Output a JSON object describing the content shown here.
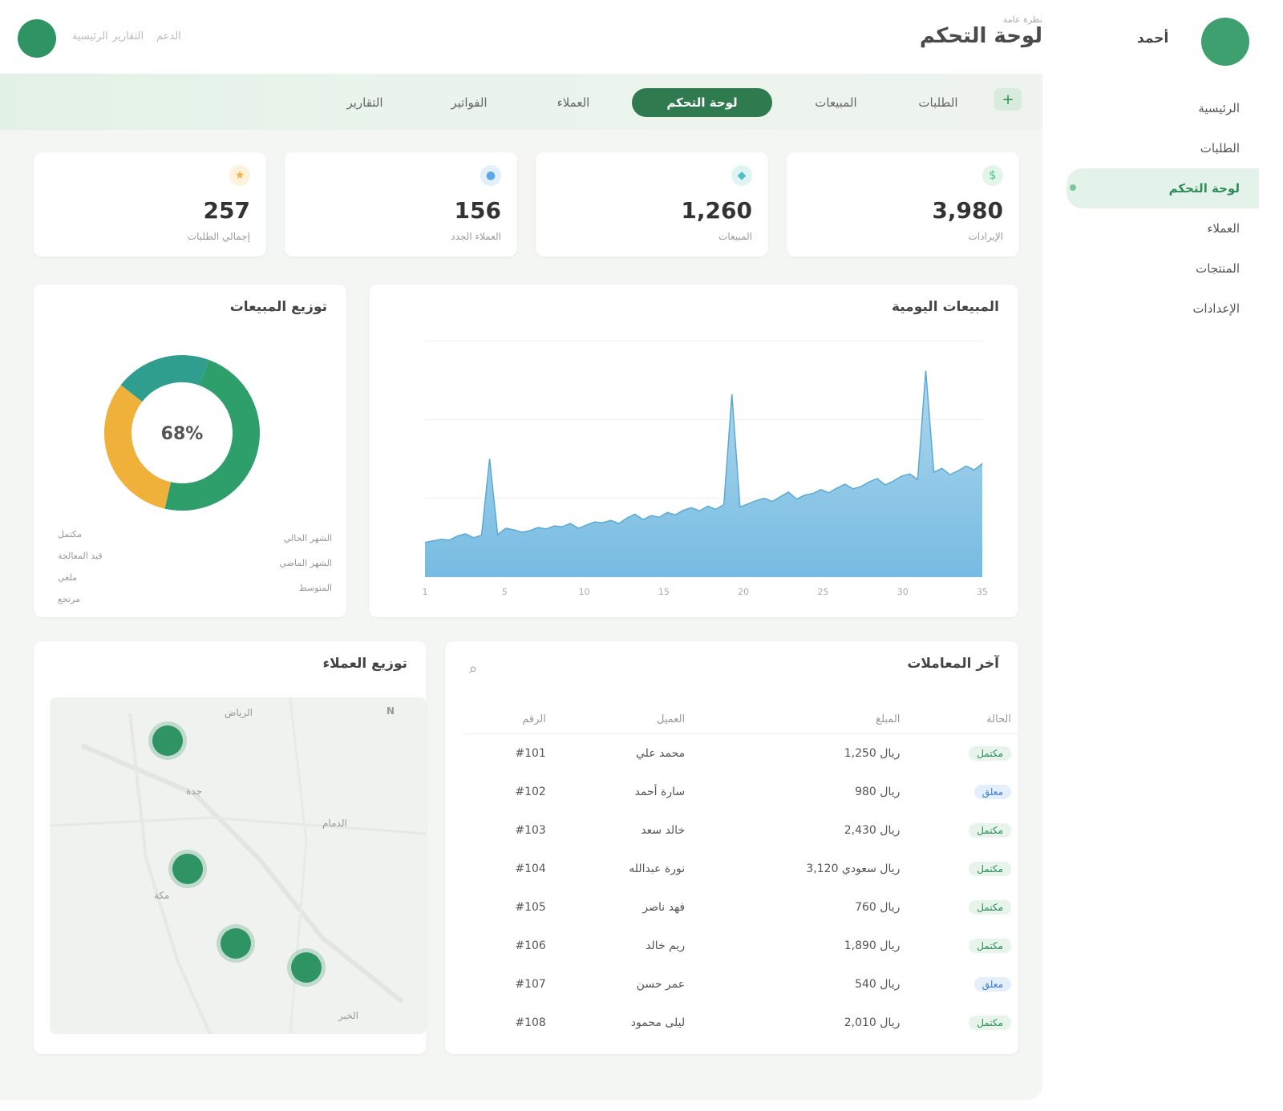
{
  "header": {
    "title": "لوحة التحكم",
    "subtitle": "نظرة عامة",
    "top_links": [
      "الرئيسية",
      "التقارير",
      "الدعم"
    ],
    "user_name": "أحمد"
  },
  "sidebar": {
    "items": [
      {
        "label": "الرئيسية"
      },
      {
        "label": "الطلبات"
      },
      {
        "label": "لوحة التحكم",
        "active": true
      },
      {
        "label": "العملاء"
      },
      {
        "label": "المنتجات"
      },
      {
        "label": "الإعدادات"
      }
    ]
  },
  "tabs": [
    {
      "label": "التقارير"
    },
    {
      "label": "الفواتير"
    },
    {
      "label": "العملاء"
    },
    {
      "label": "لوحة التحكم",
      "active": true
    },
    {
      "label": "المبيعات"
    },
    {
      "label": "الطلبات"
    }
  ],
  "kpis": [
    {
      "value": "257",
      "label": "إجمالي الطلبات",
      "icon": "star-icon",
      "color": "#f2b33d"
    },
    {
      "value": "156",
      "label": "العملاء الجدد",
      "icon": "user-icon",
      "color": "#5aa9e6"
    },
    {
      "value": "1,260",
      "label": "المبيعات",
      "icon": "cart-icon",
      "color": "#4fbfc1"
    },
    {
      "value": "3,980",
      "label": "الإيرادات",
      "icon": "dollar-icon",
      "color": "#4fbf85"
    }
  ],
  "donut": {
    "title": "توزيع المبيعات",
    "center": "68%",
    "left_legend": [
      "مكتمل",
      "قيد المعالجة",
      "ملغي",
      "مرتجع"
    ],
    "right_legend": [
      "الشهر الحالي",
      "الشهر الماضي",
      "المتوسط"
    ]
  },
  "area": {
    "title": "المبيعات اليومية",
    "x_labels": [
      "1",
      "5",
      "10",
      "15",
      "20",
      "25",
      "30",
      "35"
    ]
  },
  "chart_data": [
    {
      "type": "pie",
      "title": "توزيع المبيعات",
      "labels": [
        "مكتمل",
        "قيد المعالجة",
        "ملغي"
      ],
      "values": [
        48,
        32,
        20
      ],
      "colors": [
        "#2e9e6b",
        "#f0b13a",
        "#2f9e8f"
      ]
    },
    {
      "type": "area",
      "title": "المبيعات اليومية",
      "values": [
        44,
        46,
        48,
        47,
        52,
        55,
        50,
        53,
        58,
        54,
        62,
        60,
        57,
        59,
        63,
        61,
        65,
        64,
        68,
        62,
        66,
        70,
        69,
        72,
        68,
        75,
        80,
        73,
        78,
        76,
        82,
        79,
        85,
        88,
        84,
        90,
        86,
        92,
        95,
        89,
        93,
        97,
        100,
        96,
        102,
        108,
        99,
        104,
        106,
        111,
        107,
        113,
        118,
        112,
        115,
        121,
        125,
        117,
        122,
        128,
        131,
        124,
        127,
        133,
        138,
        130,
        135,
        141,
        136,
        144
      ],
      "spikes": [
        {
          "index": 8,
          "value": 150
        },
        {
          "index": 38,
          "value": 232
        },
        {
          "index": 62,
          "value": 262
        }
      ],
      "ylim": [
        0,
        300
      ],
      "color": "#6fb8e0"
    }
  ],
  "map": {
    "title": "توزيع العملاء",
    "labels": [
      "الرياض",
      "جدة",
      "الدمام",
      "مكة",
      "الخبر"
    ],
    "compass": "N"
  },
  "table": {
    "title": "آخر المعاملات",
    "search_icon": "search-icon",
    "headers": [
      "الرقم",
      "العميل",
      "المبلغ",
      "الحالة"
    ],
    "rows": [
      [
        "#101",
        "محمد علي",
        "1,250 ريال",
        "مكتمل"
      ],
      [
        "#102",
        "سارة أحمد",
        "980 ريال",
        "معلق"
      ],
      [
        "#103",
        "خالد سعد",
        "2,430 ريال",
        "مكتمل"
      ],
      [
        "#104",
        "نورة عبدالله",
        "3,120 ريال سعودي",
        "مكتمل"
      ],
      [
        "#105",
        "فهد ناصر",
        "760 ريال",
        "مكتمل"
      ],
      [
        "#106",
        "ريم خالد",
        "1,890 ريال",
        "مكتمل"
      ],
      [
        "#107",
        "عمر حسن",
        "540 ريال",
        "معلق"
      ],
      [
        "#108",
        "ليلى محمود",
        "2,010 ريال",
        "مكتمل"
      ]
    ],
    "status_ok": "مكتمل"
  },
  "colors": {
    "brand": "#2e9463",
    "brand_dark": "#2f7a4f",
    "tab_bg": "#e3f2e7",
    "panel_bg": "#f3f6f3",
    "area_fill": "#6fb8e0"
  }
}
